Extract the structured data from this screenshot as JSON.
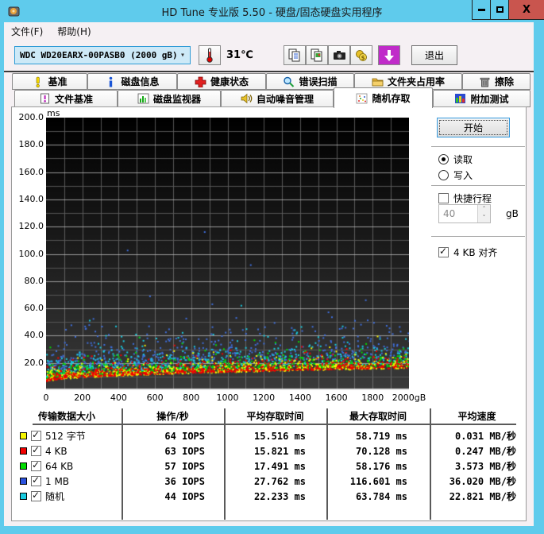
{
  "window": {
    "title": "HD Tune 专业版 5.50 - 硬盘/固态硬盘实用程序",
    "controls": [
      "minimize",
      "maximize",
      "close"
    ],
    "titlebar_color": "#5FCBEC",
    "close_color": "#C9554E"
  },
  "menu": {
    "file": "文件(F)",
    "help": "帮助(H)"
  },
  "toolbar": {
    "drive_select_value": "WDC WD20EARX-00PASB0 (2000 gB)",
    "temperature": "31℃",
    "exit_label": "退出",
    "icon_buttons": [
      "thermometer-icon",
      "copy-text-icon",
      "copy-image-icon",
      "camera-icon",
      "coins-icon",
      "download-arrow-icon"
    ]
  },
  "tabs": {
    "row1": [
      {
        "label": "基准",
        "icon": "exclamation-icon"
      },
      {
        "label": "磁盘信息",
        "icon": "info-icon"
      },
      {
        "label": "健康状态",
        "icon": "health-cross-icon"
      },
      {
        "label": "错误扫描",
        "icon": "magnifier-icon"
      },
      {
        "label": "文件夹占用率",
        "icon": "folder-icon"
      },
      {
        "label": "擦除",
        "icon": "trash-icon"
      }
    ],
    "row2": [
      {
        "label": "文件基准",
        "icon": "file-exclamation-icon"
      },
      {
        "label": "磁盘监视器",
        "icon": "bar-chart-icon"
      },
      {
        "label": "自动噪音管理",
        "icon": "speaker-icon"
      },
      {
        "label": "随机存取",
        "icon": "scatter-dots-icon",
        "active": true
      },
      {
        "label": "附加测试",
        "icon": "grid-chart-icon"
      }
    ]
  },
  "controls": {
    "start_label": "开始",
    "read_label": "读取",
    "read_checked": true,
    "write_label": "写入",
    "write_checked": false,
    "shortstroke_label": "快捷行程",
    "shortstroke_checked": false,
    "capacity_value": "40",
    "capacity_unit": "gB",
    "align_label": "4 KB 对齐",
    "align_checked": true
  },
  "results_table": {
    "headers": [
      "传输数据大小",
      "操作/秒",
      "平均存取时间",
      "最大存取时间",
      "平均速度"
    ],
    "rows": [
      {
        "color": "#F6F600",
        "checked": true,
        "label": "512 字节",
        "iops": "64 IOPS",
        "avg": "15.516 ms",
        "max": "58.719 ms",
        "speed": "0.031 MB/秒"
      },
      {
        "color": "#F20000",
        "checked": true,
        "label": "4 KB",
        "iops": "63 IOPS",
        "avg": "15.821 ms",
        "max": "70.128 ms",
        "speed": "0.247 MB/秒"
      },
      {
        "color": "#00DC00",
        "checked": true,
        "label": "64 KB",
        "iops": "57 IOPS",
        "avg": "17.491 ms",
        "max": "58.176 ms",
        "speed": "3.573 MB/秒"
      },
      {
        "color": "#2A52DE",
        "checked": true,
        "label": "1 MB",
        "iops": "36 IOPS",
        "avg": "27.762 ms",
        "max": "116.601 ms",
        "speed": "36.020 MB/秒"
      },
      {
        "color": "#18CBE0",
        "checked": true,
        "label": "随机",
        "iops": "44 IOPS",
        "avg": "22.233 ms",
        "max": "63.784 ms",
        "speed": "22.821 MB/秒"
      }
    ]
  },
  "chart_data": {
    "type": "scatter",
    "title": "随机存取 access time vs disk position",
    "ylabel_unit": "ms",
    "xlabel_unit": "gB",
    "xlim": [
      0,
      2000
    ],
    "ylim": [
      0,
      200
    ],
    "x_ticks": [
      0,
      200,
      400,
      600,
      800,
      1000,
      1200,
      1400,
      1600,
      1800,
      2000
    ],
    "x_tick_last_label": "2000gB",
    "y_ticks": [
      200,
      180,
      160,
      140,
      120,
      100,
      80,
      60,
      40,
      20
    ],
    "grid": {
      "x_step": 100,
      "y_minor_step": 10,
      "y_major_step": 20,
      "bg_top": "#000000",
      "bg_bottom": "#3A3A3A"
    },
    "seed": 1337,
    "series": [
      {
        "name": "1 MB",
        "color": "#3F6FDD",
        "points": 520,
        "band_min_start": 13,
        "band_min_end": 24,
        "spread_mean": 9,
        "max_ms": 116.601,
        "avg_ms": 27.762
      },
      {
        "name": "随机",
        "color": "#18CBE0",
        "points": 540,
        "band_min_start": 9.5,
        "band_min_end": 19.5,
        "spread_mean": 7,
        "max_ms": 63.784,
        "avg_ms": 22.233
      },
      {
        "name": "64 KB",
        "color": "#00DC00",
        "points": 620,
        "band_min_start": 8.5,
        "band_min_end": 18,
        "spread_mean": 3.6,
        "max_ms": 58.176,
        "avg_ms": 17.491
      },
      {
        "name": "512 字节",
        "color": "#F6F600",
        "points": 640,
        "band_min_start": 6.5,
        "band_min_end": 16.5,
        "spread_mean": 3.2,
        "max_ms": 58.719,
        "avg_ms": 15.516
      },
      {
        "name": "4 KB",
        "color": "#F20000",
        "points": 640,
        "band_min_start": 6.8,
        "band_min_end": 16.8,
        "spread_mean": 2.8,
        "max_ms": 70.128,
        "avg_ms": 15.821
      }
    ],
    "outliers": [
      {
        "series": "1 MB",
        "x": 870,
        "y": 116.6
      }
    ]
  }
}
